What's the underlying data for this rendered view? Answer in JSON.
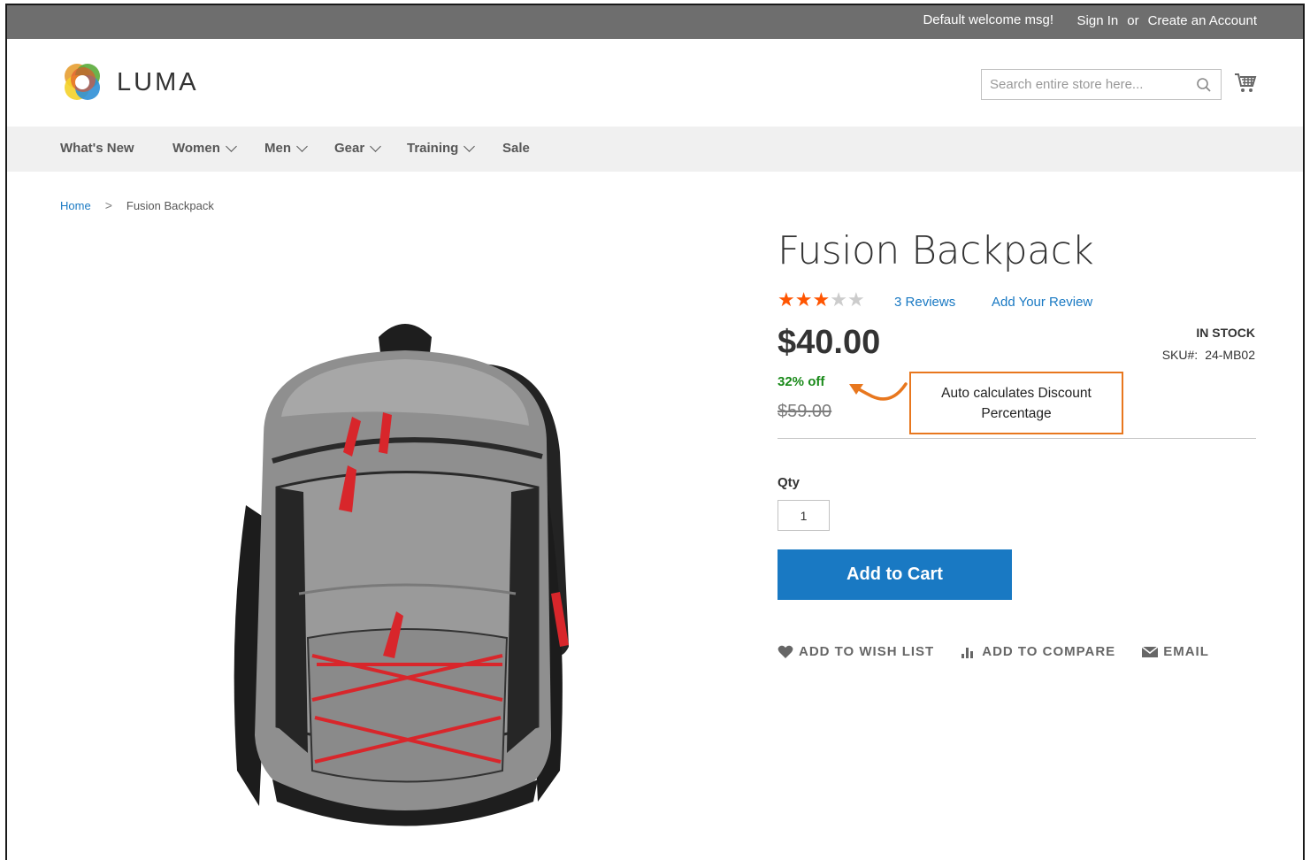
{
  "topbar": {
    "welcome": "Default welcome msg!",
    "sign_in": "Sign In",
    "or": "or",
    "create_account": "Create an Account"
  },
  "header": {
    "logo_text": "LUMA",
    "search_placeholder": "Search entire store here...",
    "icons": {
      "search": "search-icon",
      "cart": "cart-icon"
    }
  },
  "nav": {
    "items": [
      {
        "label": "What's New",
        "has_dropdown": false
      },
      {
        "label": "Women",
        "has_dropdown": true
      },
      {
        "label": "Men",
        "has_dropdown": true
      },
      {
        "label": "Gear",
        "has_dropdown": true
      },
      {
        "label": "Training",
        "has_dropdown": true
      },
      {
        "label": "Sale",
        "has_dropdown": false
      }
    ]
  },
  "breadcrumb": {
    "home": "Home",
    "separator": ">",
    "current": "Fusion Backpack"
  },
  "product": {
    "title": "Fusion Backpack",
    "rating_stars": 3,
    "rating_max": 5,
    "reviews_count": "3",
    "reviews_label": "Reviews",
    "add_review": "Add Your Review",
    "price": "$40.00",
    "stock": "IN STOCK",
    "sku_label": "SKU#:",
    "sku": "24-MB02",
    "discount": "32% off",
    "old_price": "$59.00",
    "callout": "Auto calculates Discount Percentage",
    "qty_label": "Qty",
    "qty_value": "1",
    "add_to_cart": "Add to Cart",
    "actions": {
      "wishlist": "ADD TO WISH LIST",
      "compare": "ADD TO COMPARE",
      "email": "EMAIL"
    }
  },
  "colors": {
    "accent": "#1979c3",
    "star": "#ff5501",
    "discount": "#1a8a1a",
    "callout_border": "#e8771e",
    "topbar": "#6e6e6e",
    "nav_bg": "#f0f0f0"
  }
}
